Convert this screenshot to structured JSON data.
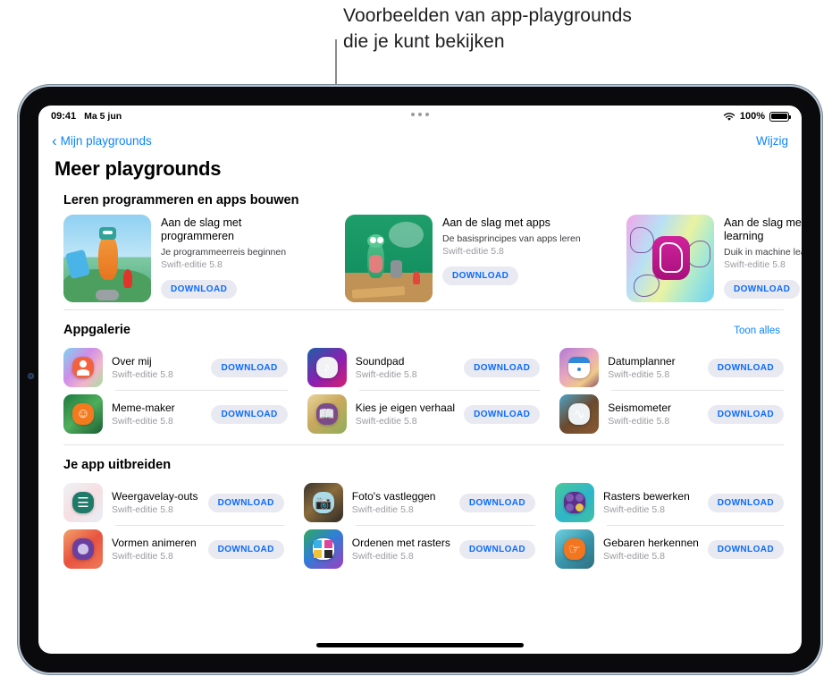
{
  "annotation": {
    "callout_text": "Voorbeelden van app-playgrounds\ndie je kunt bekijken"
  },
  "status_bar": {
    "time": "09:41",
    "date": "Ma 5 jun",
    "wifi_icon": "wifi-icon",
    "battery_percent": "100%",
    "battery_icon": "battery-full-icon",
    "multitask_icon": "multitasking-dots-icon"
  },
  "nav": {
    "back_icon": "chevron-left-icon",
    "back_label": "Mijn playgrounds",
    "edit_label": "Wijzig"
  },
  "page": {
    "title": "Meer playgrounds"
  },
  "colors": {
    "accent_blue": "#0a84ff",
    "pill_bg": "#e9e9f2",
    "pill_text": "#0a6bff",
    "version_gray": "#9a9aa0",
    "callout_line": "#8b8b8b"
  },
  "featured": {
    "heading": "Leren programmeren en apps bouwen",
    "cards": [
      {
        "title": "Aan de slag met programmeren",
        "subtitle": "Je programmeerreis beginnen",
        "version": "Swift-editie 5.8",
        "button": "DOWNLOAD",
        "thumb_icon": "robot-island-artwork"
      },
      {
        "title": "Aan de slag met apps",
        "subtitle": "De basisprincipes van apps leren",
        "version": "Swift-editie 5.8",
        "button": "DOWNLOAD",
        "thumb_icon": "lizard-thought-bubble-artwork"
      },
      {
        "title": "Aan de slag met machine learning",
        "subtitle": "Duik in machine learning",
        "version": "Swift-editie 5.8",
        "button": "DOWNLOAD",
        "thumb_icon": "hands-rainbow-artwork"
      }
    ]
  },
  "sections": [
    {
      "heading": "Appgalerie",
      "show_all": "Toon alles",
      "apps": [
        {
          "name": "Over mij",
          "version": "Swift-editie 5.8",
          "button": "DOWNLOAD",
          "icon": "over-mij-icon"
        },
        {
          "name": "Soundpad",
          "version": "Swift-editie 5.8",
          "button": "DOWNLOAD",
          "icon": "soundpad-icon"
        },
        {
          "name": "Datumplanner",
          "version": "Swift-editie 5.8",
          "button": "DOWNLOAD",
          "icon": "datumplanner-icon"
        },
        {
          "name": "Meme-maker",
          "version": "Swift-editie 5.8",
          "button": "DOWNLOAD",
          "icon": "meme-maker-icon"
        },
        {
          "name": "Kies je eigen verhaal",
          "version": "Swift-editie 5.8",
          "button": "DOWNLOAD",
          "icon": "kies-je-eigen-verhaal-icon"
        },
        {
          "name": "Seismometer",
          "version": "Swift-editie 5.8",
          "button": "DOWNLOAD",
          "icon": "seismometer-icon"
        }
      ]
    },
    {
      "heading": "Je app uitbreiden",
      "show_all": "",
      "apps": [
        {
          "name": "Weergavelay-outs",
          "version": "Swift-editie 5.8",
          "button": "DOWNLOAD",
          "icon": "weergavelay-outs-icon"
        },
        {
          "name": "Foto's vastleggen",
          "version": "Swift-editie 5.8",
          "button": "DOWNLOAD",
          "icon": "fotos-vastleggen-icon"
        },
        {
          "name": "Rasters bewerken",
          "version": "Swift-editie 5.8",
          "button": "DOWNLOAD",
          "icon": "rasters-bewerken-icon"
        },
        {
          "name": "Vormen animeren",
          "version": "Swift-editie 5.8",
          "button": "DOWNLOAD",
          "icon": "vormen-animeren-icon"
        },
        {
          "name": "Ordenen met rasters",
          "version": "Swift-editie 5.8",
          "button": "DOWNLOAD",
          "icon": "ordenen-met-rasters-icon"
        },
        {
          "name": "Gebaren herkennen",
          "version": "Swift-editie 5.8",
          "button": "DOWNLOAD",
          "icon": "gebaren-herkennen-icon"
        }
      ]
    }
  ]
}
